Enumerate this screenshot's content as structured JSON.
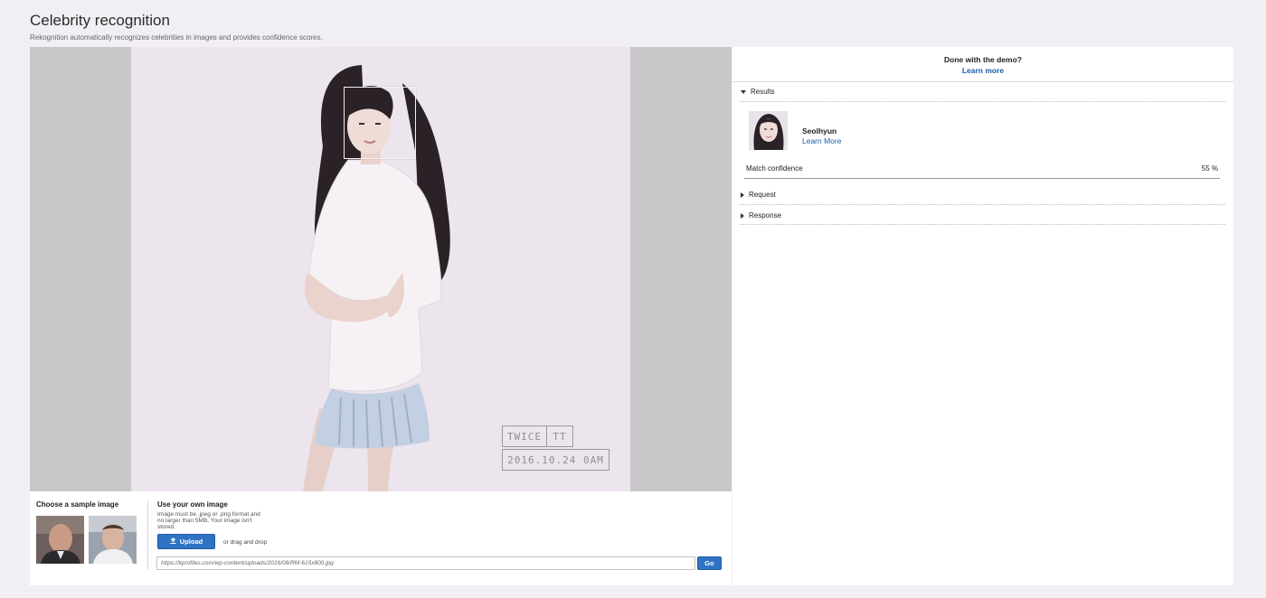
{
  "page": {
    "title": "Celebrity recognition",
    "subtitle": "Rekognition automatically recognizes celebrities in images and provides confidence scores."
  },
  "photo": {
    "watermark_group": "TWICE",
    "watermark_title": "TT",
    "watermark_date": "2016.10.24 0AM"
  },
  "controls": {
    "sample_label": "Choose a sample image",
    "own_label": "Use your own image",
    "own_help": "Image must be .jpeg or .png format and no larger than 5MB. Your image isn't stored.",
    "upload_label": "Upload",
    "drag_text": "or drag and drop",
    "url_value": "https://kprofiles.com/wp-content/uploads/2016/08/RM-615x800.jpg",
    "go_label": "Go"
  },
  "results": {
    "done_title": "Done with the demo?",
    "done_link": "Learn more",
    "results_label": "Results",
    "celebrity_name": "Seolhyun",
    "celebrity_link": "Learn More",
    "match_label": "Match confidence",
    "match_value": "55 %",
    "request_label": "Request",
    "response_label": "Response"
  },
  "colors": {
    "accent": "#2e73c4",
    "link": "#1a5ea8"
  }
}
